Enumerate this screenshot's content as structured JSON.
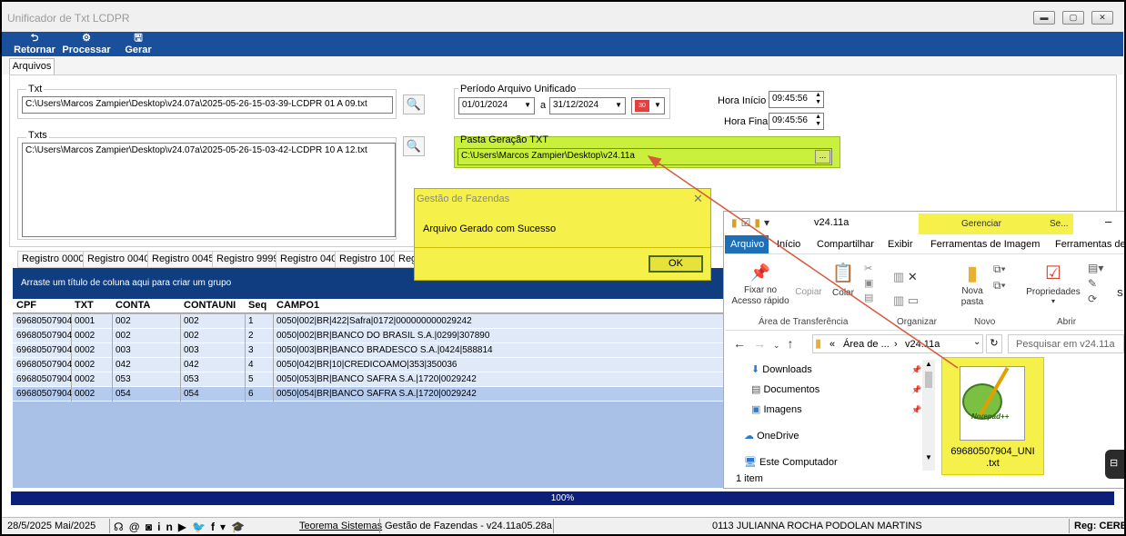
{
  "app": {
    "title": "Unificador de Txt LCDPR",
    "window_buttons": [
      "minimize-icon",
      "maximize-icon",
      "close-icon"
    ]
  },
  "toolbar": {
    "retornar": "Retornar",
    "processar": "Processar",
    "gerar": "Gerar"
  },
  "tabs": {
    "arquivos": "Arquivos"
  },
  "txt": {
    "label": "Txt",
    "value": "C:\\Users\\Marcos Zampier\\Desktop\\v24.07a\\2025-05-26-15-03-39-LCDPR 01 A 09.txt"
  },
  "txts": {
    "label": "Txts",
    "value": "C:\\Users\\Marcos Zampier\\Desktop\\v24.07a\\2025-05-26-15-03-42-LCDPR 10 A 12.txt"
  },
  "periodo": {
    "label": "Período Arquivo Unificado",
    "from": "01/01/2024",
    "sep": "a",
    "to": "31/12/2024"
  },
  "hora": {
    "inicio_label": "Hora Início",
    "inicio": "09:45:56",
    "final_label": "Hora Final",
    "final": "09:45:56"
  },
  "pasta": {
    "label": "Pasta Geração TXT",
    "value": "C:\\Users\\Marcos Zampier\\Desktop\\v24.11a",
    "browse": "..."
  },
  "grid_tabs": [
    "Registro 0000",
    "Registro 0040",
    "Registro 0045",
    "Registro 9999",
    "Registro 040",
    "Registro 100",
    "Reg"
  ],
  "grid": {
    "group_hint": "Arraste um título de coluna aqui para criar um grupo",
    "columns": [
      "CPF",
      "TXT",
      "CONTA",
      "CONTAUNI",
      "Seq",
      "CAMPO1"
    ],
    "rows": [
      [
        "69680507904",
        "0001",
        "002",
        "002",
        "1",
        "0050|002|BR|422|Safra|0172|000000000029242"
      ],
      [
        "69680507904",
        "0002",
        "002",
        "002",
        "2",
        "0050|002|BR|BANCO DO BRASIL S.A.|0299|307890"
      ],
      [
        "69680507904",
        "0002",
        "003",
        "003",
        "3",
        "0050|003|BR|BANCO BRADESCO S.A.|0424|588814"
      ],
      [
        "69680507904",
        "0002",
        "042",
        "042",
        "4",
        "0050|042|BR|10|CREDICOAMO|353|350036"
      ],
      [
        "69680507904",
        "0002",
        "053",
        "053",
        "5",
        "0050|053|BR|BANCO SAFRA S.A.|1720|0029242"
      ],
      [
        "69680507904",
        "0002",
        "054",
        "054",
        "6",
        "0050|054|BR|BANCO SAFRA S.A.|1720|0029242"
      ]
    ]
  },
  "progress": {
    "label": "100%",
    "value": 1.0
  },
  "status": {
    "date": "28/5/2025 Mai/2025",
    "company": "Teorema Sistemas",
    "version": "Gestão de Fazendas - v24.11a05.28a",
    "user": "0113 JULIANNA ROCHA PODOLAN MARTINS",
    "reg": "Reg: CEREA"
  },
  "dialog": {
    "title": "Gestão de Fazendas",
    "message": "Arquivo Gerado com Sucesso",
    "ok": "OK"
  },
  "explorer": {
    "title": "v24.11a",
    "context_tab": "Gerenciar",
    "context_tab2": "Se...",
    "ribbon_tabs": [
      "Arquivo",
      "Início",
      "Compartilhar",
      "Exibir",
      "Ferramentas de Imagem",
      "Ferramentas de"
    ],
    "ribbon_buttons": {
      "fixar": "Fixar no\nAcesso rápido",
      "copiar": "Copiar",
      "colar": "Colar",
      "nova_pasta": "Nova\npasta",
      "propriedades": "Propriedades"
    },
    "groups": [
      "Área de Transferência",
      "Organizar",
      "Novo",
      "Abrir"
    ],
    "breadcrumb": [
      "«",
      "Área de ...",
      "›",
      "v24.11a"
    ],
    "search_placeholder": "Pesquisar em v24.11a",
    "nav": [
      "Downloads",
      "Documentos",
      "Imagens",
      "OneDrive",
      "Este Computador"
    ],
    "item_count": "1 item",
    "file": {
      "name": "69680507904_UNI\n.txt",
      "app_logo_text": "Notepad++"
    }
  },
  "colors": {
    "toolbar": "#1a4f9c",
    "highlight": "#f5f14a",
    "green_highlight": "#c8f03c",
    "arrow": "#d9583a",
    "grid_bg": "#a9c1e6",
    "progress": "#0a1e7a"
  }
}
